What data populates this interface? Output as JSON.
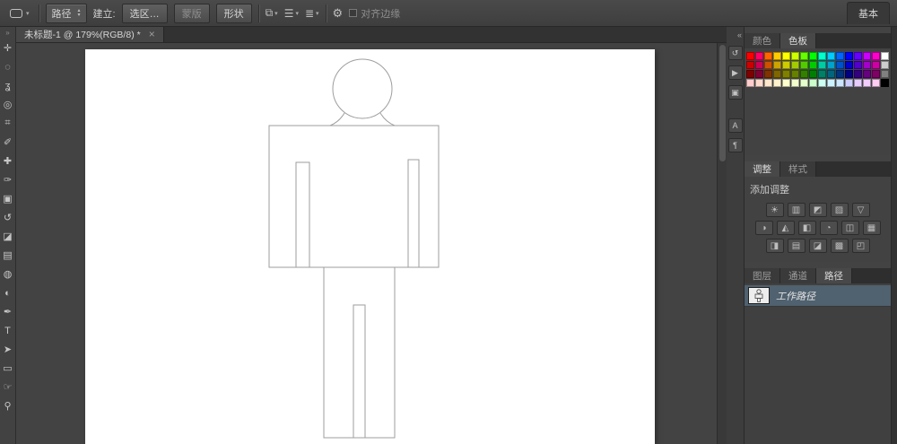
{
  "options_bar": {
    "tool_preset": {
      "dropdown_arrow": "▾"
    },
    "mode_dropdown": {
      "value": "路径",
      "up": "▴",
      "down": "▾"
    },
    "make_label": "建立:",
    "selection_button": "选区…",
    "mask_button": "蒙版",
    "shape_button": "形状",
    "path_ops": {
      "combine": "⧉",
      "align": "☰",
      "arrange": "≣",
      "dropdown_arrow": "▾"
    },
    "gear_icon": "⚙",
    "align_edges": {
      "label": "对齐边缘",
      "checked": false
    },
    "workspace_label": "基本"
  },
  "document_tab": {
    "title": "未标题-1 @ 179%(RGB/8) *",
    "close_icon": "×"
  },
  "toolbar": {
    "collapse_icon": "»",
    "tools": [
      {
        "name": "move-tool",
        "glyph": "✛"
      },
      {
        "name": "elliptical-marquee-tool",
        "glyph": "◌"
      },
      {
        "name": "lasso-tool",
        "glyph": "ʓ"
      },
      {
        "name": "quick-selection-tool",
        "glyph": "◎"
      },
      {
        "name": "crop-tool",
        "glyph": "⌗"
      },
      {
        "name": "eyedropper-tool",
        "glyph": "✐"
      },
      {
        "name": "spot-healing-brush-tool",
        "glyph": "✚"
      },
      {
        "name": "brush-tool",
        "glyph": "✑"
      },
      {
        "name": "clone-stamp-tool",
        "glyph": "▣"
      },
      {
        "name": "history-brush-tool",
        "glyph": "↺"
      },
      {
        "name": "eraser-tool",
        "glyph": "◪"
      },
      {
        "name": "gradient-tool",
        "glyph": "▤"
      },
      {
        "name": "blur-tool",
        "glyph": "◍"
      },
      {
        "name": "dodge-tool",
        "glyph": "◐"
      },
      {
        "name": "pen-tool",
        "glyph": "✒"
      },
      {
        "name": "type-tool",
        "glyph": "T"
      },
      {
        "name": "path-selection-tool",
        "glyph": "➤"
      },
      {
        "name": "rectangle-tool",
        "glyph": "▭"
      },
      {
        "name": "hand-tool",
        "glyph": "☞"
      },
      {
        "name": "zoom-tool",
        "glyph": "⚲"
      }
    ]
  },
  "panel_strip": {
    "collapse_icon": "«",
    "icons": [
      {
        "name": "history-panel-icon",
        "glyph": "↺"
      },
      {
        "name": "actions-panel-icon",
        "glyph": "▶"
      },
      {
        "name": "clone-source-panel-icon",
        "glyph": "▣"
      },
      {
        "name": "character-panel-icon",
        "glyph": "A"
      },
      {
        "name": "paragraph-panel-icon",
        "glyph": "¶"
      }
    ]
  },
  "color_panel": {
    "tabs": [
      {
        "id": "color",
        "label": "颜色",
        "active": false
      },
      {
        "id": "swatches",
        "label": "色板",
        "active": true
      }
    ],
    "swatches": [
      "#ff0000",
      "#ff0066",
      "#ff6600",
      "#ffcc00",
      "#ffff00",
      "#ccff00",
      "#66ff00",
      "#00ff00",
      "#00ffcc",
      "#00ccff",
      "#0066ff",
      "#0000ff",
      "#6600ff",
      "#cc00ff",
      "#ff00cc",
      "#ffffff",
      "#cc0000",
      "#cc0052",
      "#cc5200",
      "#cca300",
      "#cccc00",
      "#a3cc00",
      "#52cc00",
      "#00cc00",
      "#00cca3",
      "#00a3cc",
      "#0052cc",
      "#0000cc",
      "#5200cc",
      "#a300cc",
      "#cc00a3",
      "#cccccc",
      "#800000",
      "#800033",
      "#803300",
      "#806600",
      "#808000",
      "#668000",
      "#338000",
      "#008000",
      "#008066",
      "#006680",
      "#003380",
      "#000080",
      "#330080",
      "#660080",
      "#800066",
      "#808080",
      "#ffcccc",
      "#ffd9cc",
      "#ffe6cc",
      "#fff2cc",
      "#ffffcc",
      "#f2ffcc",
      "#e6ffcc",
      "#ccffcc",
      "#ccfff2",
      "#ccf2ff",
      "#cce6ff",
      "#ccccff",
      "#e6ccff",
      "#f2ccff",
      "#ffccf2",
      "#000000"
    ]
  },
  "adjustments_panel": {
    "tabs": [
      {
        "id": "adjustments",
        "label": "调整",
        "active": true
      },
      {
        "id": "styles",
        "label": "样式",
        "active": false
      }
    ],
    "header": "添加调整",
    "rows": [
      [
        {
          "name": "brightness-contrast-icon",
          "glyph": "☀"
        },
        {
          "name": "levels-icon",
          "glyph": "▥"
        },
        {
          "name": "curves-icon",
          "glyph": "◩"
        },
        {
          "name": "exposure-icon",
          "glyph": "▨"
        },
        {
          "name": "vibrance-icon",
          "glyph": "▽"
        }
      ],
      [
        {
          "name": "hue-saturation-icon",
          "glyph": "◑"
        },
        {
          "name": "color-balance-icon",
          "glyph": "◭"
        },
        {
          "name": "black-white-icon",
          "glyph": "◧"
        },
        {
          "name": "photo-filter-icon",
          "glyph": "◔"
        },
        {
          "name": "channel-mixer-icon",
          "glyph": "◫"
        },
        {
          "name": "color-lookup-icon",
          "glyph": "▦"
        }
      ],
      [
        {
          "name": "invert-icon",
          "glyph": "◨"
        },
        {
          "name": "posterize-icon",
          "glyph": "▤"
        },
        {
          "name": "threshold-icon",
          "glyph": "◪"
        },
        {
          "name": "gradient-map-icon",
          "glyph": "▩"
        },
        {
          "name": "selective-color-icon",
          "glyph": "◰"
        }
      ]
    ]
  },
  "paths_panel": {
    "tabs": [
      {
        "id": "layers",
        "label": "图层",
        "active": false
      },
      {
        "id": "channels",
        "label": "通道",
        "active": false
      },
      {
        "id": "paths",
        "label": "路径",
        "active": true
      }
    ],
    "items": [
      {
        "label": "工作路径",
        "selected": true
      }
    ]
  }
}
